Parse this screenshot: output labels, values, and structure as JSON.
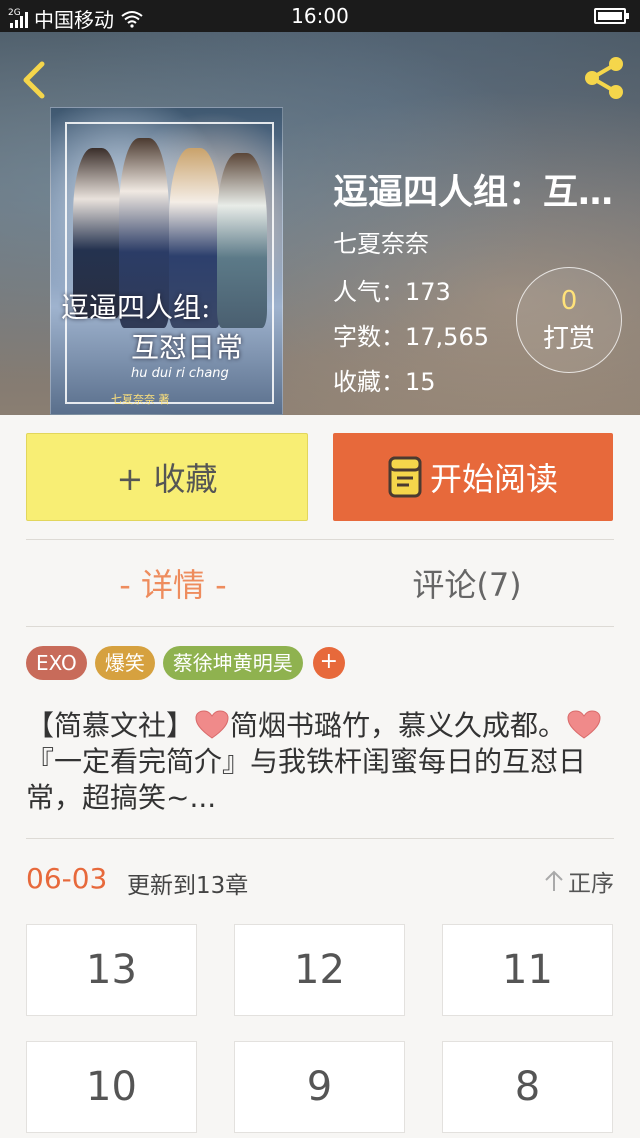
{
  "status_bar": {
    "net_type": "2G",
    "carrier": "中国移动",
    "time": "16:00"
  },
  "book": {
    "title": "逗逼四人组：互…",
    "author": "七夏奈奈",
    "popularity_label": "人气：",
    "popularity": "173",
    "word_count_label": "字数：",
    "word_count": "17,565",
    "favorites_label": "收藏：",
    "favorites": "15",
    "reward_count": "0",
    "reward_label": "打赏",
    "cover": {
      "title_line1": "逗逼四人组:",
      "title_line2": "互怼日常",
      "subtitle": "hu dui ri chang",
      "author": "七夏奈奈 著"
    }
  },
  "actions": {
    "favorite_label": "+ 收藏",
    "read_label": "开始阅读"
  },
  "tabs": {
    "detail": "- 详情 -",
    "comments": "评论(7)"
  },
  "tags": [
    {
      "label": "EXO",
      "color": "#c86b5a"
    },
    {
      "label": "爆笑",
      "color": "#d6a13f"
    },
    {
      "label": "蔡徐坤黄明昊",
      "color": "#8fb24f"
    }
  ],
  "tag_add_label": "+",
  "intro": {
    "part1": "【简慕文社】",
    "part2": "简烟书璐竹，慕义久成都。",
    "part3": "『一定看完简介』与我铁杆闺蜜每日的互怼日常，超搞笑~..."
  },
  "update": {
    "date": "06-03",
    "text": "更新到13章",
    "sort_label": "正序"
  },
  "chapters": [
    "13",
    "12",
    "11",
    "10",
    "9",
    "8"
  ],
  "colors": {
    "accent": "#e7693b",
    "tab_active": "#ee8c5d",
    "favorite_bg": "#f8ee74",
    "icon_yellow": "#f5d64b"
  }
}
